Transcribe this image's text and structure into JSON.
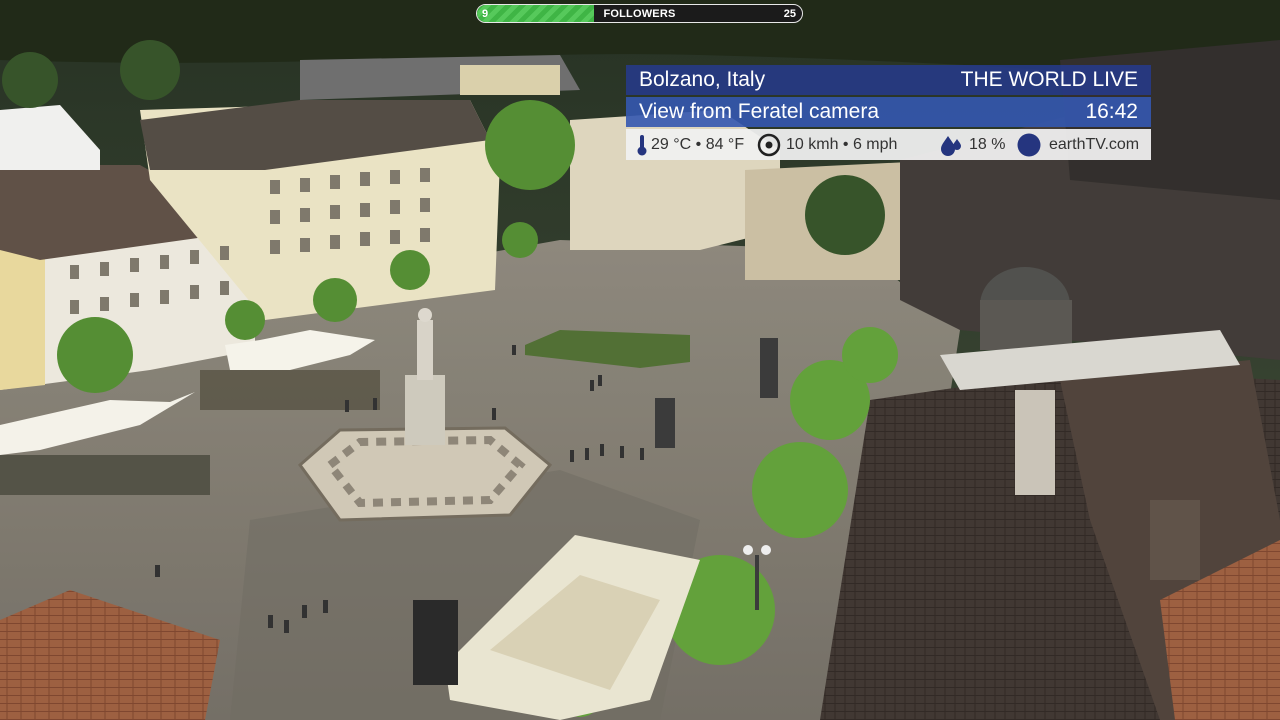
{
  "followers": {
    "current": "9",
    "label": "FOLLOWERS",
    "goal": "25",
    "progress": 0.36
  },
  "overlay": {
    "location": "Bolzano, Italy",
    "brand": "THE WORLD LIVE",
    "subtitle": "View from Feratel camera",
    "time": "16:42",
    "temperature": "29 °C • 84 °F",
    "wind": "10 kmh • 6 mph",
    "humidity": "18 %",
    "site": "earthTV.com",
    "icons": [
      "thermometer-icon",
      "wind-icon",
      "humidity-drops-icon",
      "earthtv-logo-icon"
    ]
  },
  "colors": {
    "overlay_dark": "#253a8c",
    "overlay_light": "#3458b0",
    "weather_bar": "#f0f0f0",
    "progress_green": "#4cbf51",
    "icon_blue": "#25357f"
  }
}
